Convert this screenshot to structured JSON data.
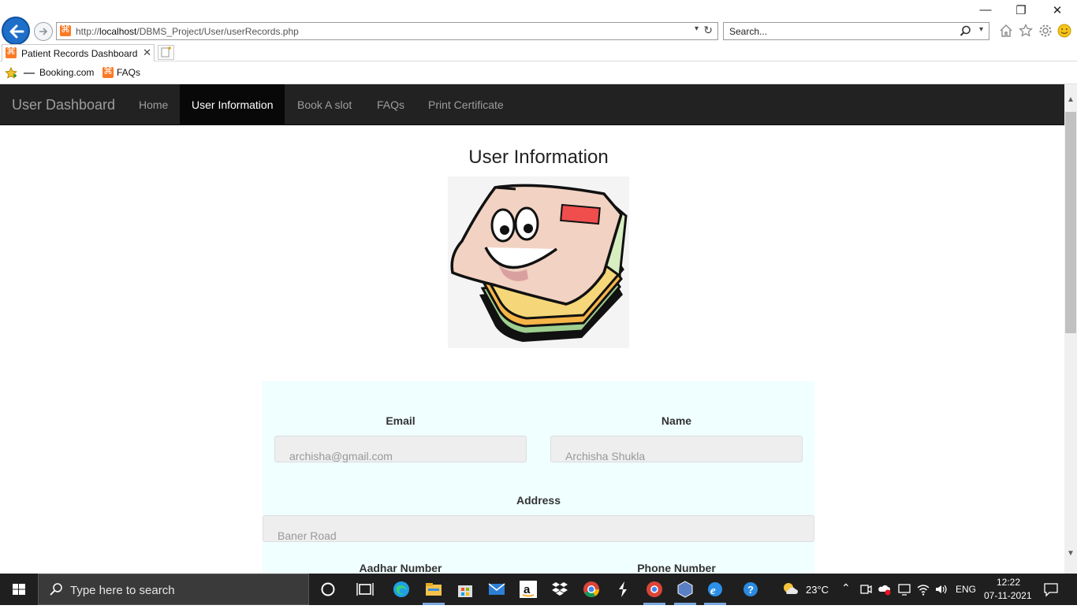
{
  "browser": {
    "url_prefix": "http://",
    "url_host": "localhost",
    "url_path": "/DBMS_Project/User/userRecords.php",
    "search_placeholder": "Search...",
    "tab_title": "Patient Records Dashboard",
    "favorites": [
      {
        "label": "Booking.com",
        "icon": "booking-icon"
      },
      {
        "label": "FAQs",
        "icon": "xampp-icon"
      }
    ]
  },
  "navbar": {
    "brand": "User Dashboard",
    "links": [
      {
        "label": "Home",
        "active": false
      },
      {
        "label": "User Information",
        "active": true
      },
      {
        "label": "Book A slot",
        "active": false
      },
      {
        "label": "FAQs",
        "active": false
      },
      {
        "label": "Print Certificate",
        "active": false
      }
    ]
  },
  "main": {
    "title": "User Information",
    "image_alt": "smiling file folder clipart",
    "fields": {
      "email": {
        "label": "Email",
        "value": "archisha@gmail.com"
      },
      "name": {
        "label": "Name",
        "value": "Archisha Shukla"
      },
      "address": {
        "label": "Address",
        "value": "Baner Road"
      },
      "aadhar": {
        "label": "Aadhar Number"
      },
      "phone": {
        "label": "Phone Number"
      }
    }
  },
  "taskbar": {
    "search_placeholder": "Type here to search",
    "weather": "23°C",
    "language": "ENG",
    "time": "12:22",
    "date": "07-11-2021"
  },
  "colors": {
    "navbar_bg": "#222222",
    "navbar_active_bg": "#080808",
    "panel_bg": "#f0ffff",
    "field_bg": "#eeeeee"
  }
}
